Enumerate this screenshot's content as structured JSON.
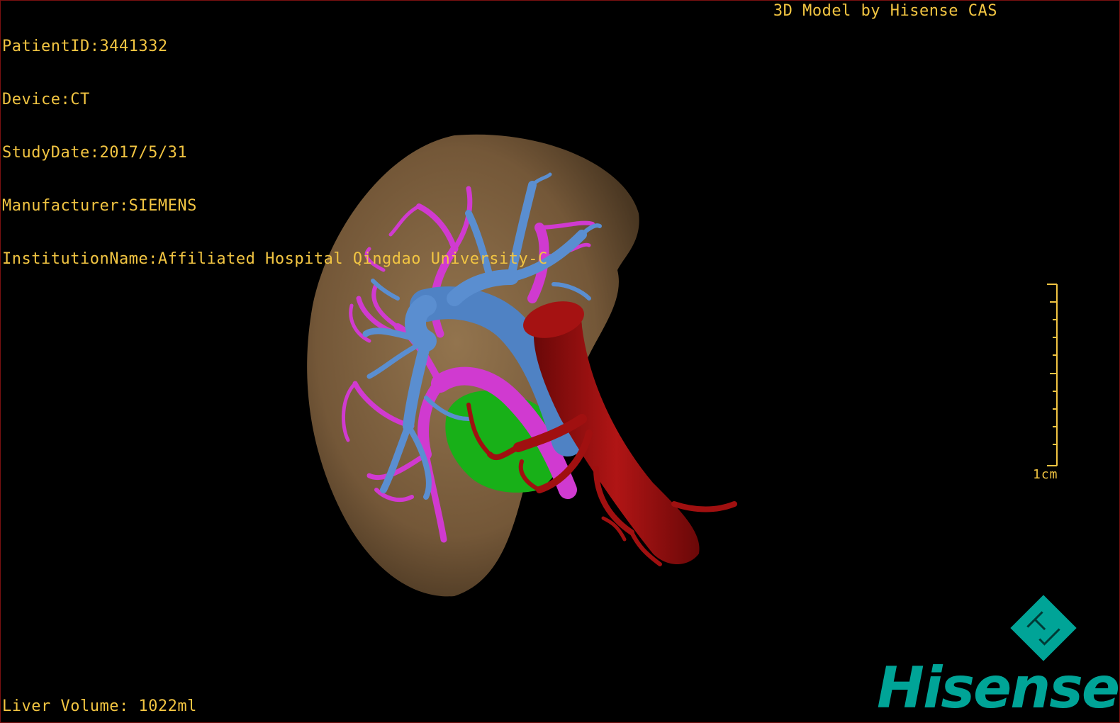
{
  "dicom": {
    "patient_id": "PatientID:3441332",
    "device": "Device:CT",
    "study_date": "StudyDate:2017/5/31",
    "manufacturer": "Manufacturer:SIEMENS",
    "institution": "InstitutionName:Affiliated Hospital Qingdao University-C"
  },
  "caption": "3D Model by Hisense CAS",
  "liver_volume": "Liver Volume: 1022ml",
  "scale": {
    "label": "1cm"
  },
  "logo": {
    "brand": "Hisense",
    "mark_icon": "hisense-diamond-logo-icon"
  },
  "colors": {
    "overlay_text": "#f2c542",
    "liver": "#8a6a45",
    "portal_vein": "#5a8ed0",
    "hepatic_vein": "#d03ad0",
    "aorta_artery": "#a01010",
    "gallbladder": "#18b018",
    "brand": "#00a497"
  }
}
